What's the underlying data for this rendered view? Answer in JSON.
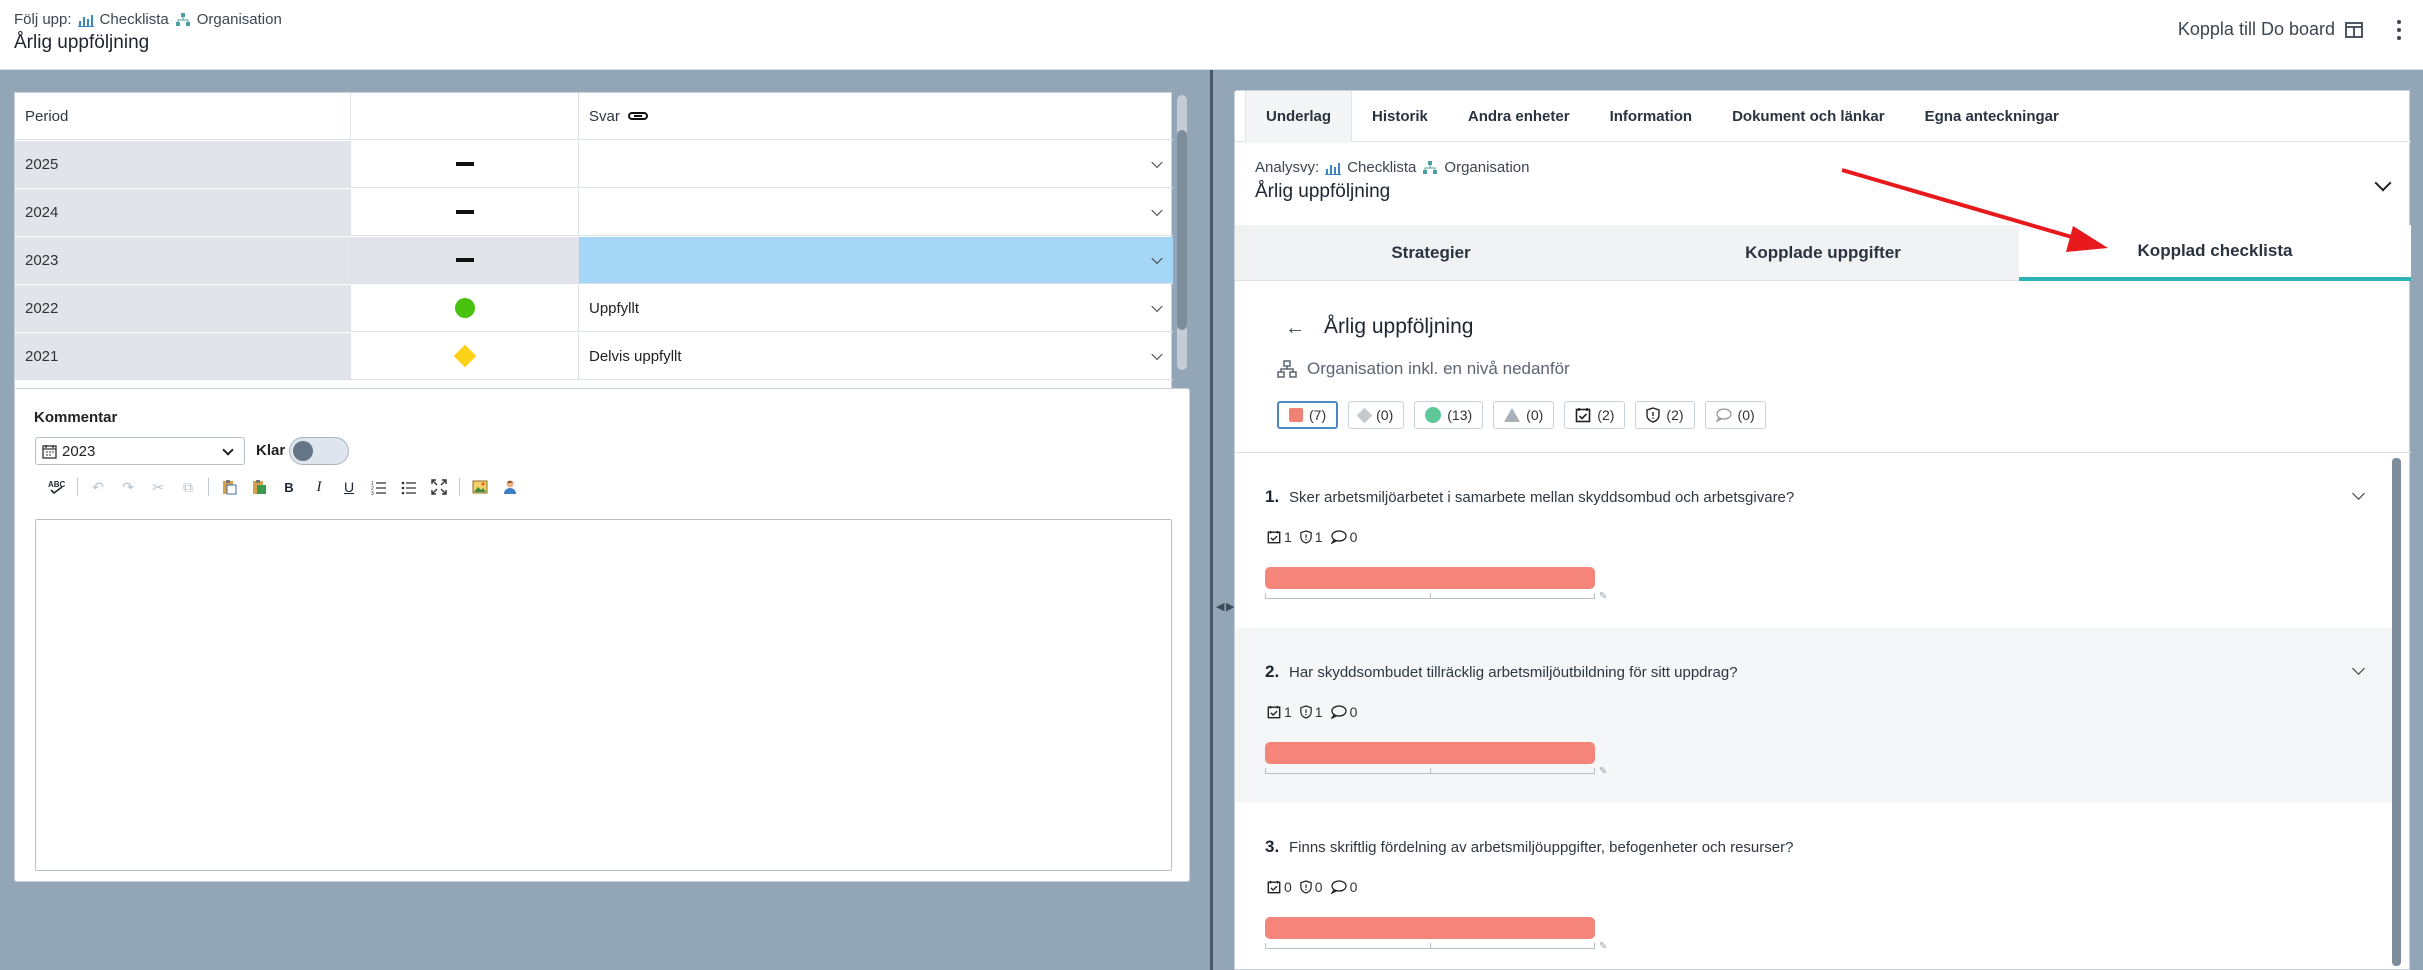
{
  "header": {
    "crumb_prefix": "Följ upp:",
    "crumb_checklist": "Checklista",
    "crumb_org": "Organisation",
    "title": "Årlig uppföljning",
    "connect_label": "Koppla till Do board"
  },
  "grid": {
    "headers": {
      "period": "Period",
      "status": "",
      "answer": "Svar"
    },
    "rows": [
      {
        "period": "2025",
        "status": "dash",
        "answer": ""
      },
      {
        "period": "2024",
        "status": "dash",
        "answer": ""
      },
      {
        "period": "2023",
        "status": "dash",
        "answer": "",
        "selected": true
      },
      {
        "period": "2022",
        "status": "green-dot",
        "answer": "Uppfyllt"
      },
      {
        "period": "2021",
        "status": "yellow-diamond",
        "answer": "Delvis uppfyllt"
      }
    ]
  },
  "comment": {
    "label": "Kommentar",
    "year": "2023",
    "klar_label": "Klar",
    "klar_on": false,
    "editor_text": ""
  },
  "right": {
    "tabs": [
      "Underlag",
      "Historik",
      "Andra enheter",
      "Information",
      "Dokument och länkar",
      "Egna anteckningar"
    ],
    "active_tab": "Underlag",
    "analys_prefix": "Analysvy:",
    "analys_checklist": "Checklista",
    "analys_org": "Organisation",
    "analys_title": "Årlig uppföljning",
    "subtabs": [
      "Strategier",
      "Kopplade uppgifter",
      "Kopplad checklista"
    ],
    "active_subtab": "Kopplad checklista",
    "checklist_title": "Årlig uppföljning",
    "org_line": "Organisation inkl. en nivå nedanför",
    "filters": [
      {
        "icon": "red-square",
        "count": "(7)",
        "selected": true
      },
      {
        "icon": "grey-diamond",
        "count": "(0)"
      },
      {
        "icon": "teal-dot",
        "count": "(13)"
      },
      {
        "icon": "grey-triangle",
        "count": "(0)"
      },
      {
        "icon": "task-icon",
        "count": "(2)"
      },
      {
        "icon": "shield-icon",
        "count": "(2)"
      },
      {
        "icon": "comment-icon",
        "count": "(0)"
      }
    ],
    "questions": [
      {
        "num": "1.",
        "text": "Sker arbetsmiljöarbetet i samarbete mellan skyddsombud och arbetsgivare?",
        "tasks": "1",
        "shields": "1",
        "comments": "0",
        "progress": 1.0
      },
      {
        "num": "2.",
        "text": "Har skyddsombudet tillräcklig arbetsmiljöutbildning för sitt uppdrag?",
        "tasks": "1",
        "shields": "1",
        "comments": "0",
        "progress": 1.0
      },
      {
        "num": "3.",
        "text": "Finns skriftlig fördelning av arbetsmiljöuppgifter, befogenheter och resurser?",
        "tasks": "0",
        "shields": "0",
        "comments": "0",
        "progress": 1.0
      }
    ]
  },
  "colors": {
    "accent_teal": "#2fb2b5",
    "bar_red": "#f5857a",
    "selected_row": "#a6d6f5",
    "annotation_arrow": "#e8191c"
  }
}
